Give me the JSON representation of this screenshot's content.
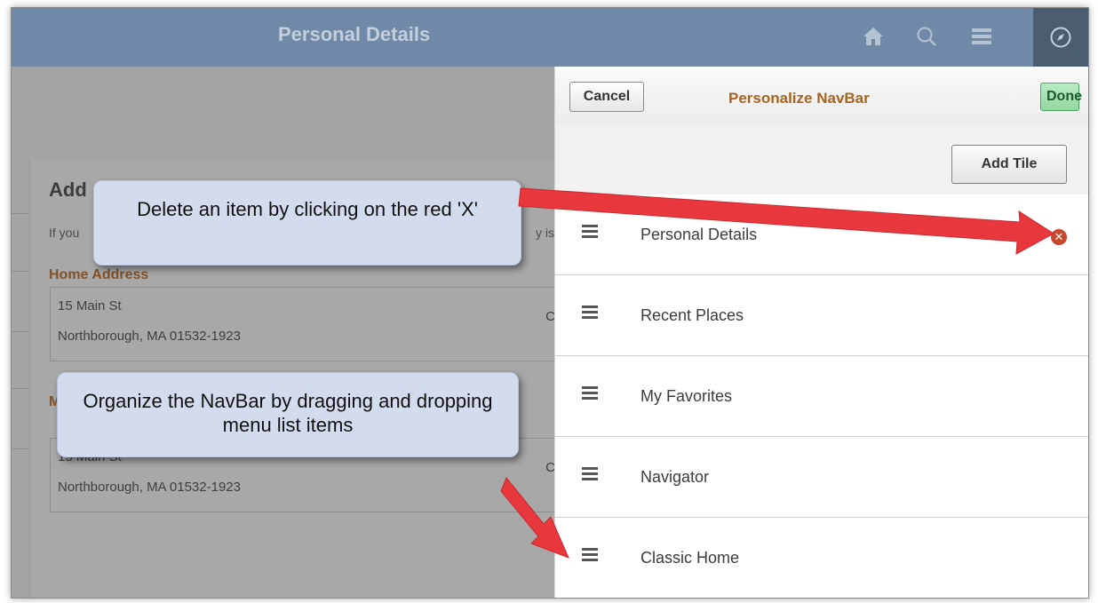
{
  "header": {
    "title": "Personal Details",
    "icons": [
      "home-icon",
      "search-icon",
      "menu-icon",
      "navigator-icon"
    ]
  },
  "background_page": {
    "section_title": "Add",
    "info_text": "If you",
    "info_text_tail": "y is",
    "home_address": {
      "label": "Home Address",
      "line1": "15 Main St",
      "line2": "Northborough, MA 01532-1923",
      "trailing": "C"
    },
    "mailing_address": {
      "label": "M",
      "line1": "15 Main St",
      "line2": "Northborough, MA 01532-1923",
      "trailing": "C"
    }
  },
  "panel": {
    "cancel_label": "Cancel",
    "title": "Personalize NavBar",
    "done_label": "Done",
    "add_tile_label": "Add Tile",
    "items": [
      {
        "label": "Personal Details"
      },
      {
        "label": "Recent Places"
      },
      {
        "label": "My Favorites"
      },
      {
        "label": "Navigator"
      },
      {
        "label": "Classic Home"
      }
    ]
  },
  "callouts": {
    "delete": "Delete an item by clicking on the red 'X'",
    "organize": "Organize the NavBar by dragging and dropping menu list items"
  },
  "colors": {
    "header": "#6f89a6",
    "panel_title": "#a8641e",
    "done_button": "#93d8a3",
    "delete_icon": "#c8452e",
    "arrow": "#e8383d",
    "callout": "#d3dbee"
  }
}
